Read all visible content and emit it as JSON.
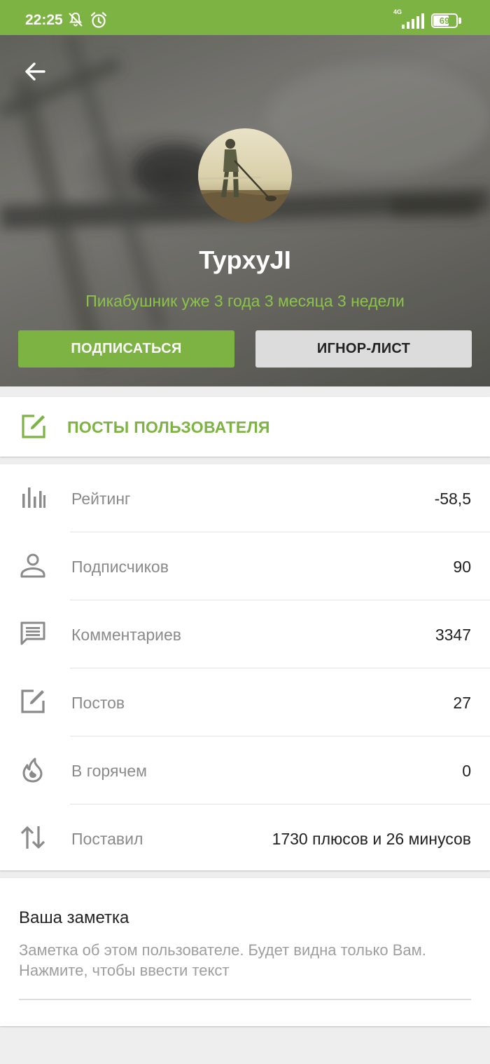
{
  "status_bar": {
    "time": "22:25",
    "network": "4G",
    "battery": "69",
    "battery_fraction": 0.69,
    "icons": [
      "bell-off-icon",
      "alarm-icon",
      "signal-icon",
      "battery-icon"
    ]
  },
  "header": {
    "username": "TypxyJI",
    "since": "Пикабушник уже 3 года 3 месяца 3 недели",
    "subscribe_label": "ПОДПИСАТЬСЯ",
    "ignore_label": "ИГНОР-ЛИСТ"
  },
  "posts": {
    "label": "ПОСТЫ ПОЛЬЗОВАТЕЛЯ",
    "icon": "edit-icon"
  },
  "stats": [
    {
      "label": "Рейтинг",
      "value": "-58,5",
      "icon": "rating-bars-icon"
    },
    {
      "label": "Подписчиков",
      "value": "90",
      "icon": "person-icon"
    },
    {
      "label": "Комментариев",
      "value": "3347",
      "icon": "comment-icon"
    },
    {
      "label": "Постов",
      "value": "27",
      "icon": "edit-icon"
    },
    {
      "label": "В горячем",
      "value": "0",
      "icon": "flame-icon"
    },
    {
      "label": "Поставил",
      "value": "1730 плюсов и 26 минусов",
      "icon": "sort-arrows-icon"
    }
  ],
  "note": {
    "title": "Ваша заметка",
    "placeholder": "Заметка об этом пользователе. Будет видна только Вам. Нажмите, чтобы ввести текст"
  },
  "colors": {
    "accent": "#7cb342",
    "accent_light": "#8bc34a",
    "button_gray": "#dcdcdc"
  }
}
